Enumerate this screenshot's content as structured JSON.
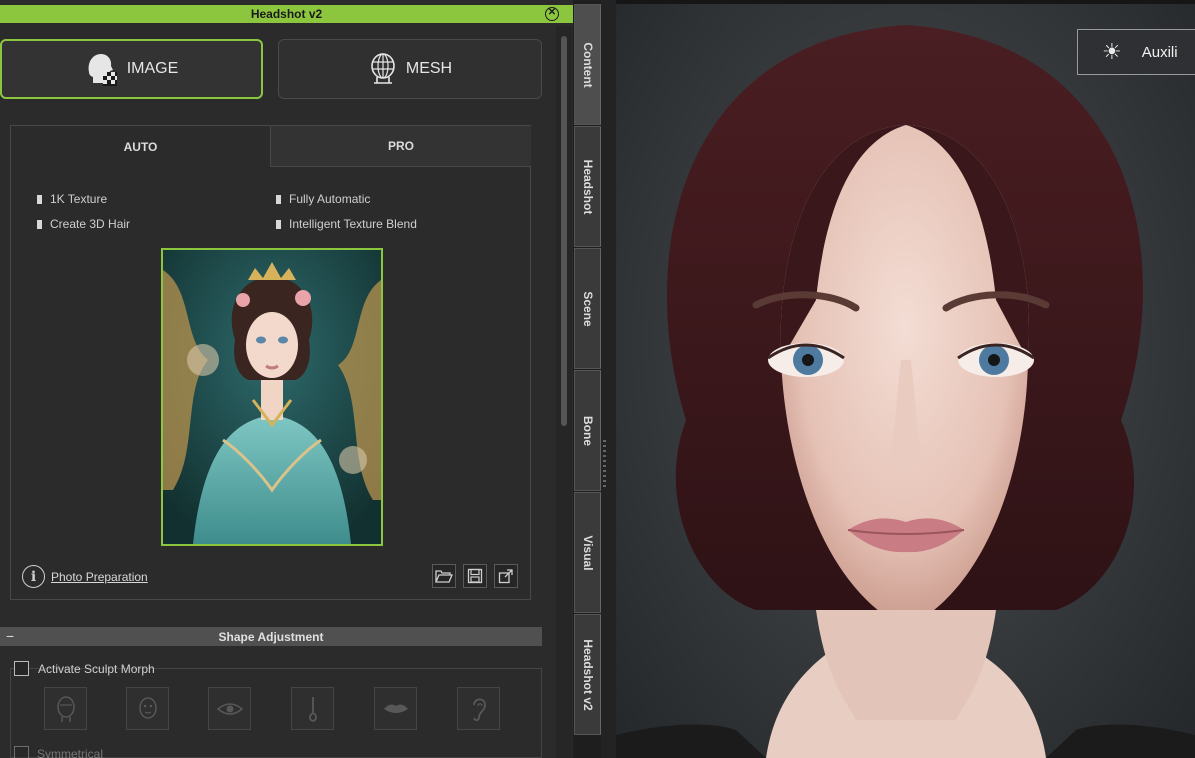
{
  "window": {
    "title": "Headshot v2"
  },
  "modes": {
    "image_label": "IMAGE",
    "mesh_label": "MESH"
  },
  "tabs": {
    "auto": "AUTO",
    "pro": "PRO"
  },
  "features": [
    "1K Texture",
    "Fully Automatic",
    "Create 3D Hair",
    "Intelligent Texture Blend"
  ],
  "photo_prep": {
    "link": "Photo Preparation"
  },
  "icons": [
    "open-folder-icon",
    "save-icon",
    "expand-icon"
  ],
  "shape_adjustment": {
    "title": "Shape Adjustment",
    "activate_label": "Activate Sculpt Morph",
    "symmetrical_label": "Symmetrical",
    "morph_icons": [
      "head-icon",
      "face-icon",
      "eye-icon",
      "nose-icon",
      "mouth-icon",
      "ear-icon"
    ]
  },
  "side_tabs": [
    "Content",
    "Headshot",
    "Scene",
    "Bone",
    "Visual",
    "Headshot v2"
  ],
  "viewport": {
    "auxiliary_label": "Auxili"
  },
  "colors": {
    "accent": "#8cc63f",
    "panel_bg": "#2b2b2b"
  }
}
